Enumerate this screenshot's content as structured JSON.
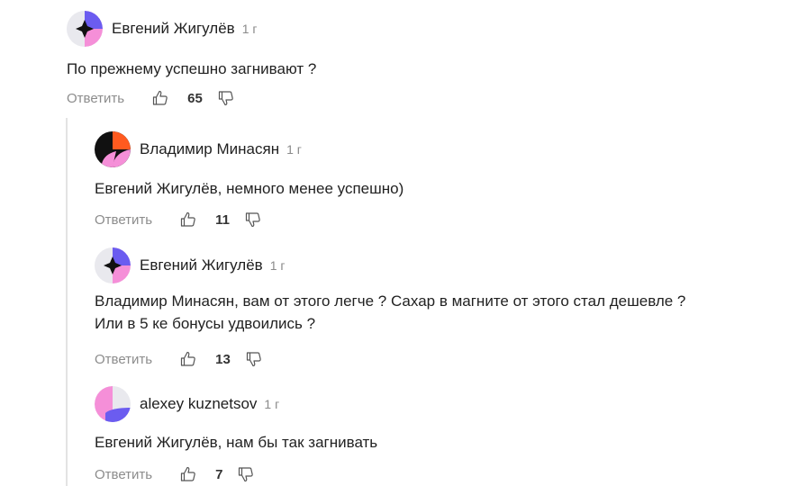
{
  "comments": [
    {
      "author": "Евгений Жигулёв",
      "time": "1 г",
      "text": "По прежнему успешно загнивают ?",
      "reply_label": "Ответить",
      "likes": "65",
      "avatar": "star-pink-purple"
    },
    {
      "author": "Владимир Минасян",
      "time": "1 г",
      "text": "Евгений Жигулёв, немного менее успешно)",
      "reply_label": "Ответить",
      "likes": "11",
      "avatar": "orange-black-pink"
    },
    {
      "author": "Евгений Жигулёв",
      "time": "1 г",
      "text_line1": "Владимир Минасян, вам от этого легче ? Сахар в магните от этого стал дешевле ?",
      "text_line2": "Или в 5 ке бонусы удвоились ?",
      "reply_label": "Ответить",
      "likes": "13",
      "avatar": "star-pink-purple"
    },
    {
      "author": "alexey kuznetsov",
      "time": "1 г",
      "text": "Евгений Жигулёв, нам бы так загнивать",
      "reply_label": "Ответить",
      "likes": "7",
      "avatar": "pink-purple-gray"
    }
  ],
  "colors": {
    "pink": "#f58fd8",
    "purple": "#6b5cf0",
    "orange": "#ff5a1f",
    "black": "#111111",
    "gray_avatar": "#e9e9ee",
    "reply_text": "#8c8c8c"
  }
}
